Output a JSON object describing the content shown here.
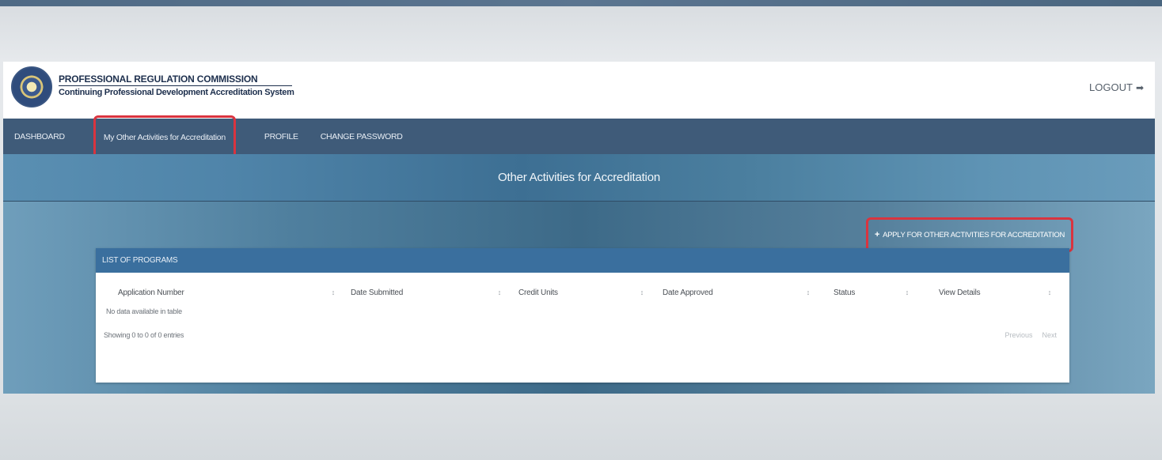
{
  "header": {
    "org_name": "PROFESSIONAL REGULATION COMMISSION",
    "system_name": "Continuing Professional Development Accreditation System",
    "logout_label": "LOGOUT",
    "logout_icon": "logout-icon"
  },
  "nav": {
    "items": [
      {
        "label": "DASHBOARD"
      },
      {
        "label": "My Other Activities for Accreditation"
      },
      {
        "label": "PROFILE"
      },
      {
        "label": "CHANGE PASSWORD"
      }
    ]
  },
  "hero": {
    "title": "Other Activities for Accreditation"
  },
  "actions": {
    "apply_label": "APPLY FOR OTHER ACTIVITIES FOR ACCREDITATION",
    "apply_icon": "plus-icon"
  },
  "table": {
    "panel_title": "LIST OF PROGRAMS",
    "columns": [
      "Application Number",
      "Date Submitted",
      "Credit Units",
      "Date Approved",
      "Status",
      "View Details"
    ],
    "empty_message": "No data available in table",
    "info": "Showing 0 to 0 of 0 entries",
    "pager": {
      "previous": "Previous",
      "next": "Next"
    }
  },
  "colors": {
    "nav_bg": "#3f5b79",
    "panel_head_bg": "#3a6f9e",
    "highlight_border": "#d9343f",
    "brand_text": "#1d2f4d"
  }
}
